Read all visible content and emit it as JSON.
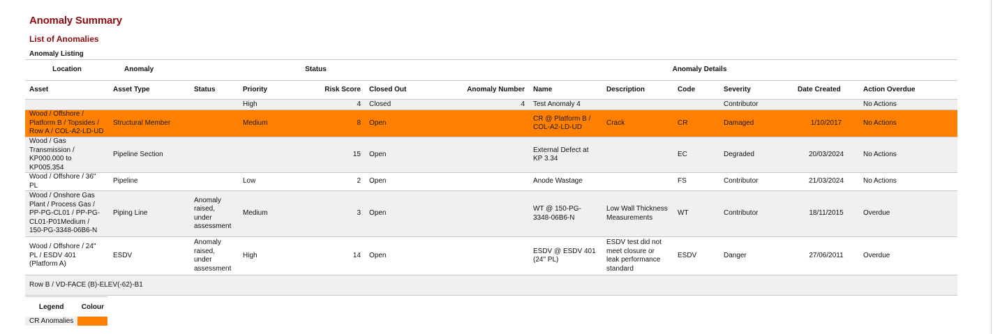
{
  "page": {
    "title": "Anomaly Summary",
    "subtitle": "List of Anomalies",
    "section": "Anomaly Listing"
  },
  "colors": {
    "title": "#8b0d0d",
    "highlight": "#ff8000",
    "row_gray": "#f0f0f0",
    "border": "#c8c8c8"
  },
  "groups": {
    "location": "Location",
    "anomaly": "Anomaly",
    "status": "Status",
    "details": "Anomaly Details"
  },
  "columns": {
    "asset": "Asset",
    "asset_type": "Asset Type",
    "status": "Status",
    "priority": "Priority",
    "risk_score": "Risk Score",
    "closed_out": "Closed Out",
    "anomaly_number": "Anomaly Number",
    "name": "Name",
    "description": "Description",
    "code": "Code",
    "severity": "Severity",
    "date_created": "Date Created",
    "action_overdue": "Action Overdue"
  },
  "rows": [
    {
      "asset": "",
      "asset_type": "",
      "status": "",
      "priority": "High",
      "risk_score": "4",
      "closed_out": "Closed",
      "anomaly_number": "4",
      "name": "Test Anomaly 4",
      "description": "",
      "code": "",
      "severity": "Contributor",
      "date_created": "",
      "action_overdue": "No Actions"
    },
    {
      "asset": "Wood / Offshore / Platform B / Topsides / Row A / COL-A2-LD-UD",
      "asset_type": "Structural Member",
      "status": "",
      "priority": "Medium",
      "risk_score": "8",
      "closed_out": "Open",
      "anomaly_number": "",
      "name": "CR @ Platform B / COL-A2-LD-UD",
      "description": "Crack",
      "code": "CR",
      "severity": "Damaged",
      "date_created": "1/10/2017",
      "action_overdue": "No Actions"
    },
    {
      "asset": "Wood / Gas Transmission / KP000.000 to KP005.354",
      "asset_type": "Pipeline Section",
      "status": "",
      "priority": "",
      "risk_score": "15",
      "closed_out": "Open",
      "anomaly_number": "",
      "name": "External Defect at KP 3.34",
      "description": "",
      "code": "EC",
      "severity": "Degraded",
      "date_created": "20/03/2024",
      "action_overdue": "No Actions"
    },
    {
      "asset": "Wood / Offshore / 36\" PL",
      "asset_type": "Pipeline",
      "status": "",
      "priority": "Low",
      "risk_score": "2",
      "closed_out": "Open",
      "anomaly_number": "",
      "name": "Anode Wastage",
      "description": "",
      "code": "FS",
      "severity": "Contributor",
      "date_created": "21/03/2024",
      "action_overdue": "No Actions"
    },
    {
      "asset": "Wood / Onshore Gas Plant / Process Gas / PP-PG-CL01 / PP-PG-CL01-P01Medium / 150-PG-3348-06B6-N",
      "asset_type": "Piping Line",
      "status": "Anomaly raised, under assessment",
      "priority": "Medium",
      "risk_score": "3",
      "closed_out": "Open",
      "anomaly_number": "",
      "name": "WT @ 150-PG-3348-06B6-N",
      "description": "Low Wall Thickness Measurements",
      "code": "WT",
      "severity": "Contributor",
      "date_created": "18/11/2015",
      "action_overdue": "Overdue"
    },
    {
      "asset": "Wood / Offshore / 24\" PL / ESDV 401 (Platform A)",
      "asset_type": "ESDV",
      "status": "Anomaly raised, under assessment",
      "priority": "High",
      "risk_score": "14",
      "closed_out": "Open",
      "anomaly_number": "",
      "name": "ESDV @ ESDV 401 (24\" PL)",
      "description": "ESDV test did not meet closure or leak performance standard",
      "code": "ESDV",
      "severity": "Danger",
      "date_created": "27/06/2011",
      "action_overdue": "Overdue"
    },
    {
      "asset": "Row B / VD-FACE (B)-ELEV(-62)-B1",
      "asset_type": "",
      "status": "",
      "priority": "",
      "risk_score": "",
      "closed_out": "",
      "anomaly_number": "",
      "name": "",
      "description": "",
      "code": "",
      "severity": "",
      "date_created": "",
      "action_overdue": ""
    }
  ],
  "legend": {
    "col1": "Legend",
    "col2": "Colour",
    "items": [
      {
        "label": "CR Anomalies",
        "color": "#ff8000"
      }
    ]
  }
}
